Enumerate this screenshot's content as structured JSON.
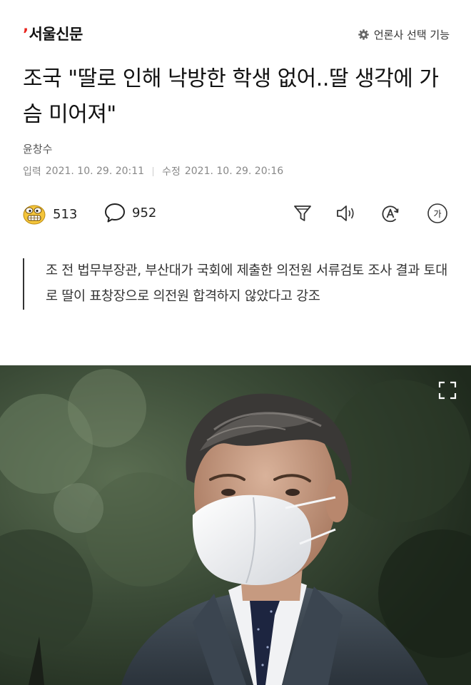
{
  "header": {
    "logo_tick": "’",
    "logo": "서울신문",
    "press_select_label": "언론사 선택 기능"
  },
  "article": {
    "title": "조국 \"딸로 인해 낙방한 학생 없어..딸 생각에 가슴 미어져\"",
    "author": "윤창수",
    "input_label": "입력",
    "input_date": "2021. 10. 29. 20:11",
    "modified_label": "수정",
    "modified_date": "2021. 10. 29. 20:16",
    "summary": "조 전 법무부장관, 부산대가 국회에 제출한 의전원 서류검토 조사 결과 토대로 딸이 표창장으로 의전원 합격하지 않았다고 강조"
  },
  "actions": {
    "reaction_count": "513",
    "comment_count": "952",
    "tools": [
      "summary-filter-icon",
      "audio-icon",
      "translate-icon",
      "font-size-icon"
    ],
    "font_size_glyph": "가"
  },
  "photo": {
    "expand_icon": "fullscreen-icon"
  },
  "colors": {
    "logo_accent": "#e8221b",
    "text": "#111111",
    "muted": "#888888"
  }
}
